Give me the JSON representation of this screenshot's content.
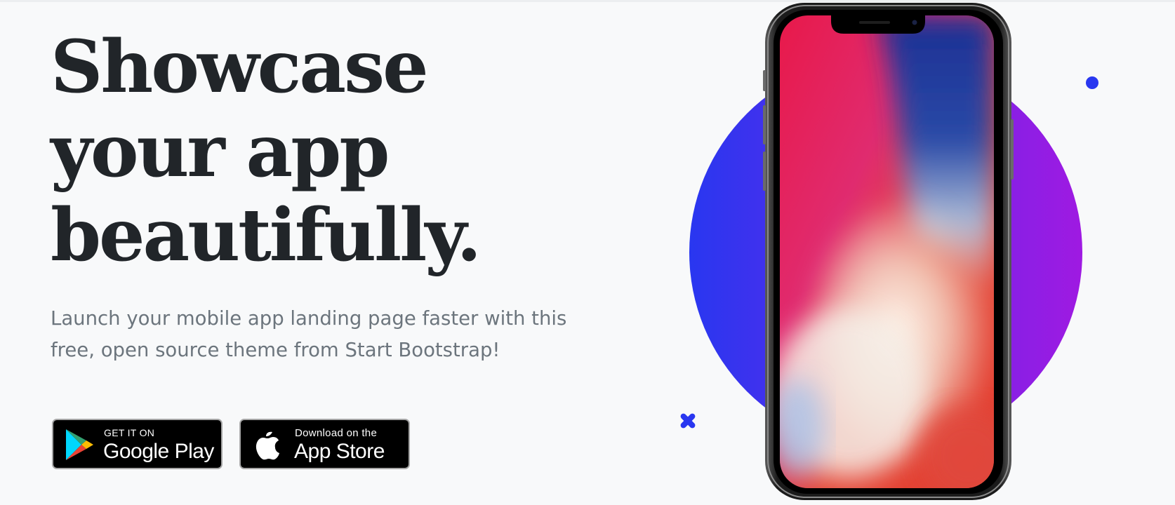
{
  "hero": {
    "headline_lines": [
      "Showcase",
      "your app",
      "beautifully."
    ],
    "lede": "Launch your mobile app landing page faster with this free, open source theme from Start Bootstrap!"
  },
  "badges": {
    "google_play": {
      "top_label": "GET IT ON",
      "main_label": "Google Play",
      "icon": "google-play-icon"
    },
    "app_store": {
      "top_label": "Download on the",
      "main_label": "App Store",
      "icon": "apple-icon"
    }
  },
  "colors": {
    "page_background": "#f8f9fa",
    "headline": "#212529",
    "lede": "#6c757d",
    "circle_gradient_start": "#2937f0",
    "circle_gradient_end": "#9f1ae2",
    "accent_shapes": "#2937f0"
  },
  "device": {
    "model": "phone-mockup",
    "screen": "abstract-wallpaper"
  }
}
